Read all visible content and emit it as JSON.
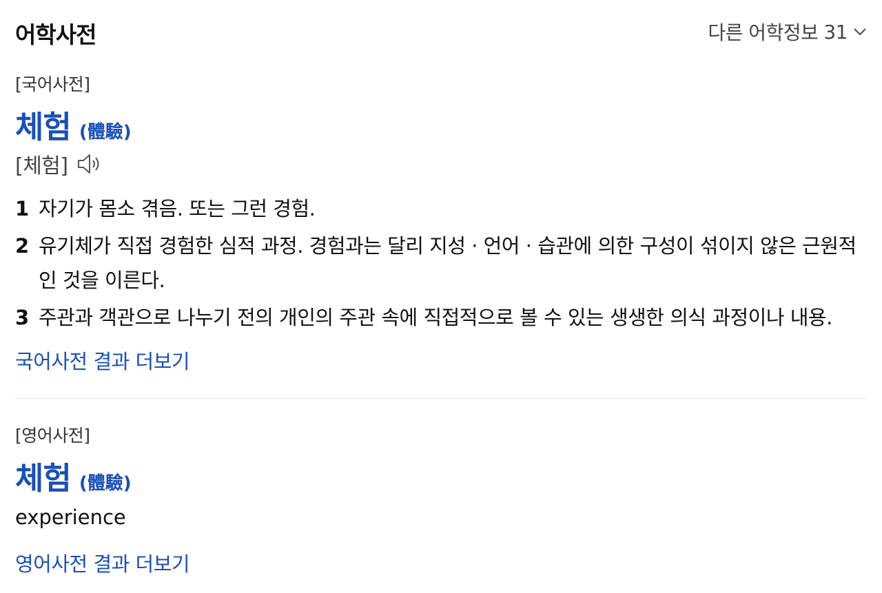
{
  "header": {
    "title": "어학사전",
    "more_label": "다른 어학정보",
    "more_count": "31"
  },
  "korean_dict": {
    "label": "[국어사전]",
    "headword": "체험",
    "hanja": "(體驗)",
    "pronunciation": "[체험]",
    "definitions": [
      {
        "num": "1",
        "text": "자기가 몸소 겪음. 또는 그런 경험."
      },
      {
        "num": "2",
        "text": "유기체가 직접 경험한 심적 과정. 경험과는 달리 지성 · 언어 · 습관에 의한 구성이 섞이지 않은 근원적인 것을 이른다."
      },
      {
        "num": "3",
        "text": "주관과 객관으로 나누기 전의 개인의 주관 속에 직접적으로 볼 수 있는 생생한 의식 과정이나 내용."
      }
    ],
    "more_link": "국어사전 결과 더보기"
  },
  "english_dict": {
    "label": "[영어사전]",
    "headword": "체험",
    "hanja": "(體驗)",
    "translation": "experience",
    "more_link": "영어사전 결과 더보기"
  },
  "colors": {
    "link": "#1a4fb5",
    "text": "#111111",
    "divider": "#e5e5e5"
  }
}
